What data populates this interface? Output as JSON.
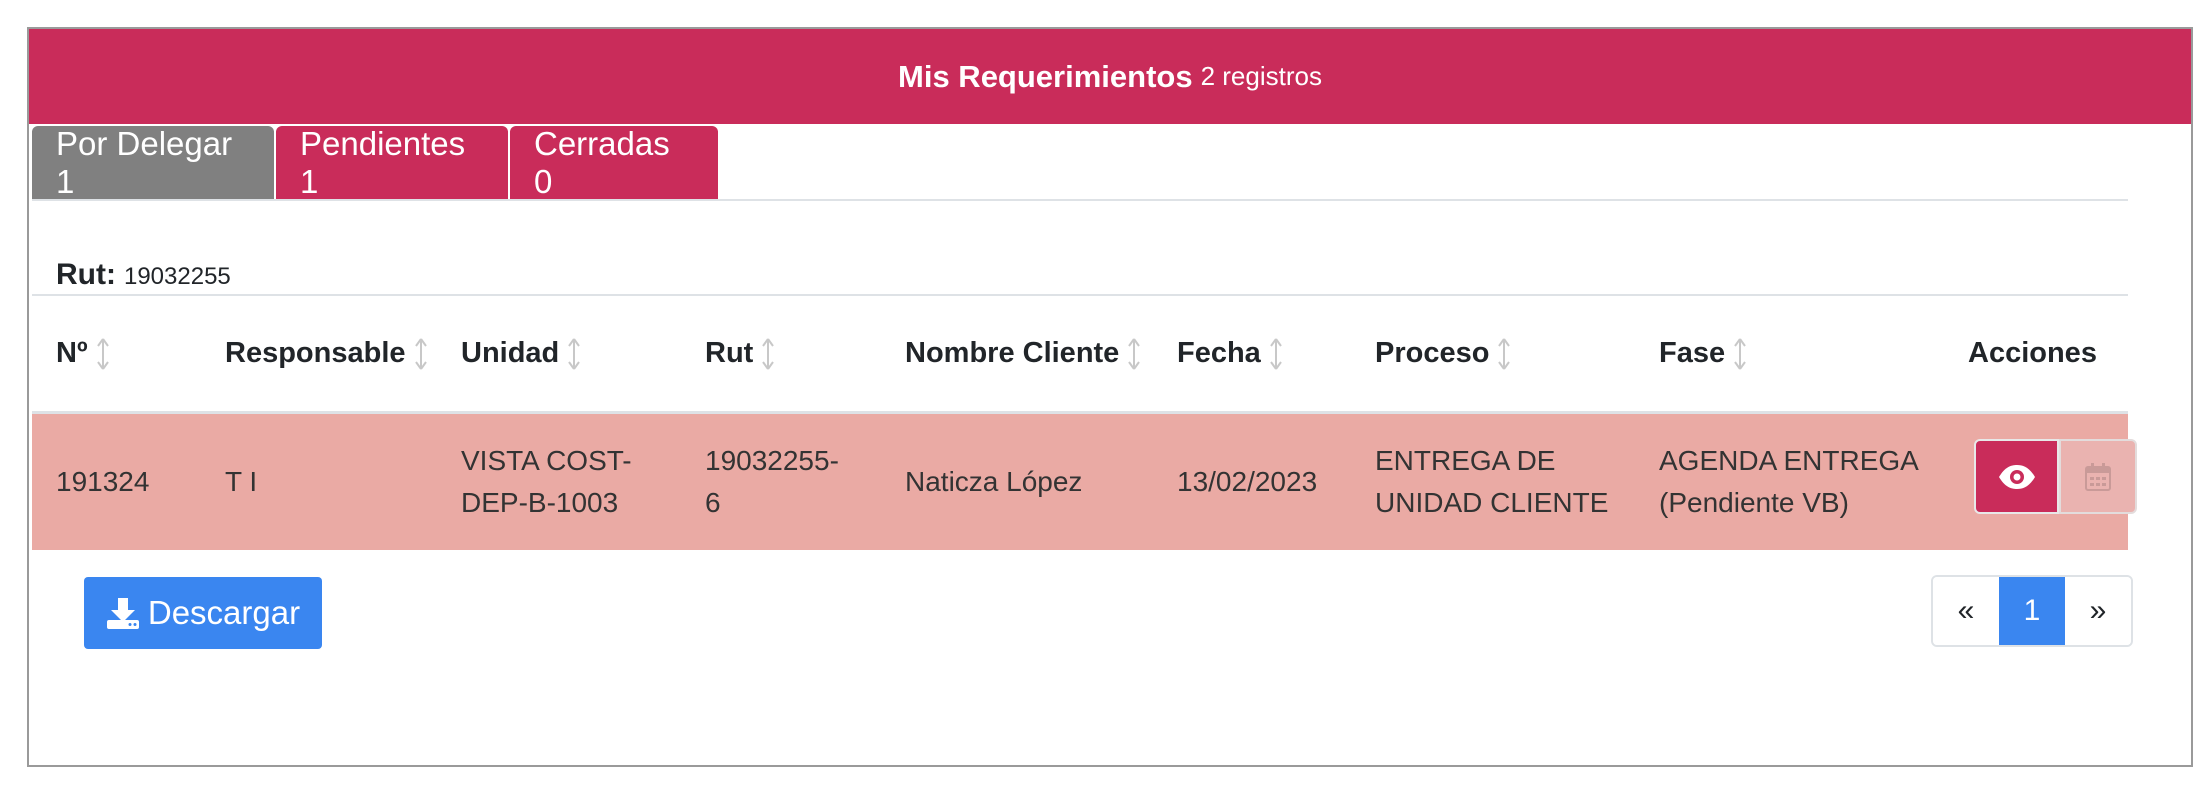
{
  "header": {
    "title": "Mis Requerimientos",
    "count": "2 registros"
  },
  "tabs": [
    {
      "label": "Por Delegar 1"
    },
    {
      "label": "Pendientes 1"
    },
    {
      "label": "Cerradas 0"
    }
  ],
  "rut": {
    "label": "Rut:",
    "value": "19032255"
  },
  "table": {
    "headers": {
      "numero": "Nº",
      "responsable": "Responsable",
      "unidad": "Unidad",
      "rut": "Rut",
      "nombre_cliente": "Nombre Cliente",
      "fecha": "Fecha",
      "proceso": "Proceso",
      "fase": "Fase",
      "acciones": "Acciones"
    },
    "rows": [
      {
        "numero": "191324",
        "responsable": "T I",
        "unidad_1": "VISTA COST-",
        "unidad_2": "DEP-B-1003",
        "rut_1": "19032255-",
        "rut_2": "6",
        "nombre_cliente": "Naticza López",
        "fecha": "13/02/2023",
        "proceso_1": "ENTREGA DE",
        "proceso_2": "UNIDAD CLIENTE",
        "fase_1": "AGENDA ENTREGA",
        "fase_2": "(Pendiente VB)"
      }
    ]
  },
  "actions": {
    "view_icon": "eye-icon",
    "calendar_icon": "calendar-icon"
  },
  "download": {
    "label": "Descargar",
    "icon": "download-icon"
  },
  "pagination": {
    "prev": "«",
    "current": "1",
    "next": "»"
  },
  "colors": {
    "primary": "#c92c5a",
    "tab_inactive": "#808080",
    "row_highlight": "#eaaaa4",
    "blue": "#3a86f0"
  }
}
